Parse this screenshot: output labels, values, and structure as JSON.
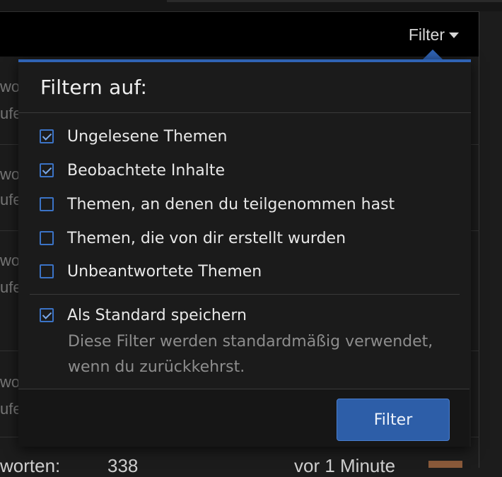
{
  "header": {
    "filter_toggle_label": "Filter"
  },
  "background": {
    "row_fragment_a": "wo",
    "row_fragment_b": "ufe",
    "bottom_label": "worten:",
    "bottom_count": "338",
    "bottom_time": "vor 1 Minute"
  },
  "menu": {
    "title": "Filtern auf:",
    "options": [
      {
        "label": "Ungelesene Themen",
        "checked": true
      },
      {
        "label": "Beobachtete Inhalte",
        "checked": true
      },
      {
        "label": "Themen, an denen du teilgenommen hast",
        "checked": false
      },
      {
        "label": "Themen, die von dir erstellt wurden",
        "checked": false
      },
      {
        "label": "Unbeantwortete Themen",
        "checked": false
      }
    ],
    "save_default": {
      "label": "Als Standard speichern",
      "checked": true,
      "hint": "Diese Filter werden standardmäßig verwendet, wenn du zurückkehrst."
    },
    "submit_label": "Filter"
  },
  "colors": {
    "accent": "#2f63b4",
    "button": "#2d5ea8",
    "checkbox": "#3b73c6"
  }
}
